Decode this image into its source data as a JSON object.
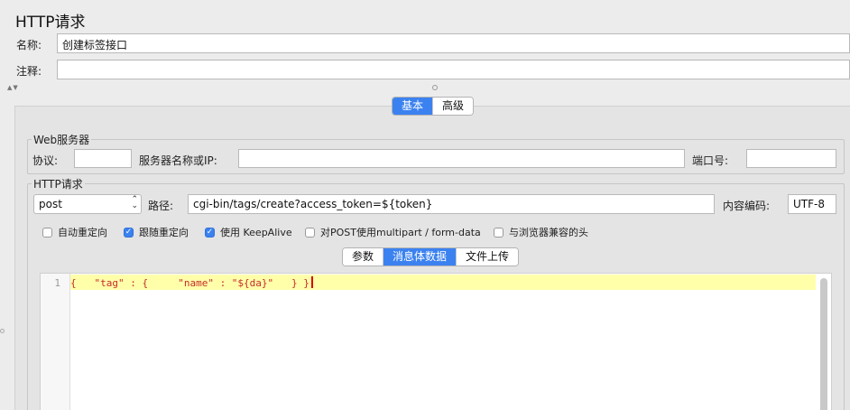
{
  "header": {
    "title": "HTTP请求"
  },
  "name_field": {
    "label": "名称:",
    "value": "创建标签接口"
  },
  "comment_field": {
    "label": "注释:",
    "value": ""
  },
  "main_tabs": [
    {
      "label": "基本",
      "active": true
    },
    {
      "label": "高级",
      "active": false
    }
  ],
  "web_server": {
    "group_title": "Web服务器",
    "protocol_label": "协议:",
    "protocol_value": "",
    "server_label": "服务器名称或IP:",
    "server_value": "",
    "port_label": "端口号:",
    "port_value": ""
  },
  "http_request": {
    "group_title": "HTTP请求",
    "method": "post",
    "path_label": "路径:",
    "path_value": "cgi-bin/tags/create?access_token=${token}",
    "encoding_label": "内容编码:",
    "encoding_value": "UTF-8"
  },
  "options": [
    {
      "label": "自动重定向",
      "checked": false
    },
    {
      "label": "跟随重定向",
      "checked": true
    },
    {
      "label": "使用 KeepAlive",
      "checked": true
    },
    {
      "label": "对POST使用multipart / form-data",
      "checked": false
    },
    {
      "label": "与浏览器兼容的头",
      "checked": false
    }
  ],
  "body_tabs": [
    {
      "label": "参数",
      "active": false
    },
    {
      "label": "消息体数据",
      "active": true
    },
    {
      "label": "文件上传",
      "active": false
    }
  ],
  "editor": {
    "line_number": "1",
    "code": "{   \"tag\" : {     \"name\" : \"${da}\"   } }"
  },
  "colors": {
    "accent": "#3b82f0",
    "code_text": "#c62b2b",
    "current_line": "#ffffaa"
  }
}
